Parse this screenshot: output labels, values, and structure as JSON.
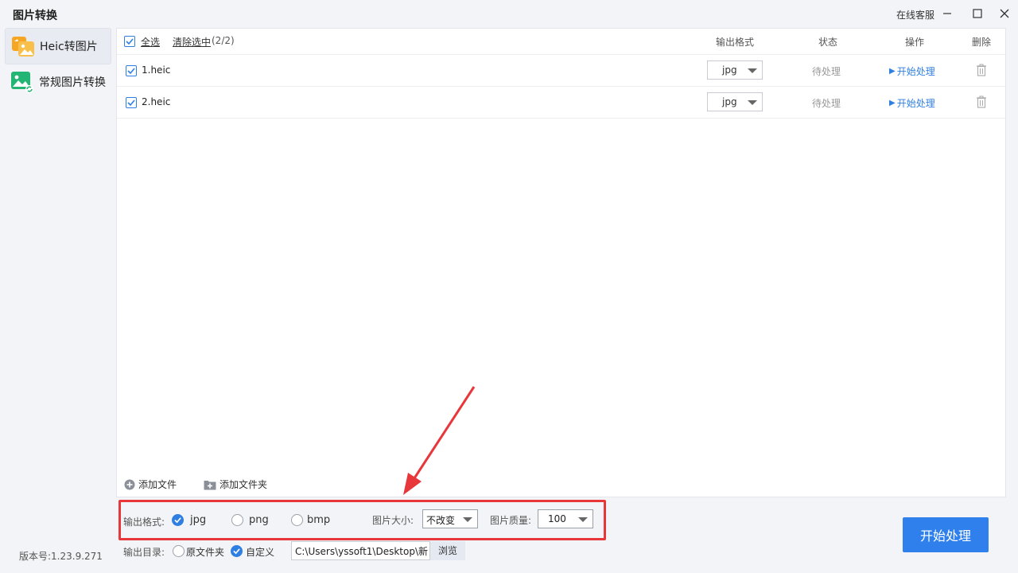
{
  "app": {
    "title": "图片转换",
    "service_label": "在线客服"
  },
  "sidebar": {
    "items": [
      {
        "label": "Heic转图片",
        "active": true,
        "icon": "heic-convert-icon"
      },
      {
        "label": "常规图片转换",
        "active": false,
        "icon": "image-convert-icon"
      }
    ],
    "version": "版本号:1.23.9.271"
  },
  "list": {
    "select_all": "全选",
    "clear_selected": "清除选中",
    "selected_count": "(2/2)",
    "columns": {
      "format": "输出格式",
      "status": "状态",
      "action": "操作",
      "delete": "删除"
    },
    "rows": [
      {
        "name": "1.heic",
        "format": "jpg",
        "status": "待处理",
        "action": "开始处理",
        "checked": true
      },
      {
        "name": "2.heic",
        "format": "jpg",
        "status": "待处理",
        "action": "开始处理",
        "checked": true
      }
    ],
    "add_file": "添加文件",
    "add_folder": "添加文件夹"
  },
  "settings": {
    "format_label": "输出格式:",
    "formats": [
      {
        "label": "jpg",
        "checked": true
      },
      {
        "label": "png",
        "checked": false
      },
      {
        "label": "bmp",
        "checked": false
      }
    ],
    "size_label": "图片大小:",
    "size_value": "不改变",
    "quality_label": "图片质量:",
    "quality_value": "100",
    "dir_label": "输出目录:",
    "dir_options": [
      {
        "label": "原文件夹",
        "checked": false
      },
      {
        "label": "自定义",
        "checked": true
      }
    ],
    "path_value": "C:\\Users\\yssoft1\\Desktop\\新",
    "browse_label": "浏览"
  },
  "start_button": "开始处理",
  "colors": {
    "accent": "#2f80ed",
    "highlight": "#e8373b"
  }
}
